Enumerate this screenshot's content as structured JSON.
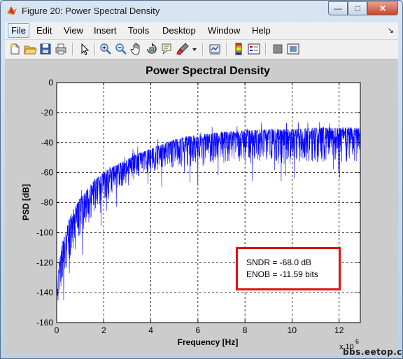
{
  "window": {
    "title": "Figure 20: Power Spectral Density",
    "minimize": "—",
    "maximize": "□",
    "close": "✕"
  },
  "menu": {
    "items": [
      "File",
      "Edit",
      "View",
      "Insert",
      "Tools",
      "Desktop",
      "Window",
      "Help"
    ],
    "dock_arrow": "↘"
  },
  "toolbar": {
    "icons": [
      "new-figure-icon",
      "open-file-icon",
      "save-icon",
      "print-icon",
      "arrow-select-icon",
      "zoom-in-icon",
      "zoom-out-icon",
      "pan-hand-icon",
      "rotate-3d-icon",
      "data-cursor-icon",
      "brush-icon",
      "brush-dropdown-icon",
      "link-plot-icon",
      "colorbar-icon",
      "legend-icon",
      "hide-plot-tools-icon",
      "show-plot-tools-icon"
    ]
  },
  "chart_data": {
    "type": "line",
    "title": "Power Spectral Density",
    "xlabel": "Frequency [Hz]",
    "ylabel": "PSD [dB]",
    "x_multiplier_label": "x 10",
    "x_multiplier_exp": "6",
    "xlim": [
      0,
      12.9
    ],
    "ylim": [
      -160,
      0
    ],
    "xticks": [
      "0",
      "2",
      "4",
      "6",
      "8",
      "10",
      "12"
    ],
    "yticks": [
      "0",
      "-20",
      "-40",
      "-60",
      "-80",
      "-100",
      "-120",
      "-140",
      "-160"
    ],
    "grid": true,
    "line_color": "#0000ff",
    "series": [
      {
        "x": [
          0.05,
          0.1,
          0.2,
          0.3,
          0.4,
          0.5,
          0.7,
          1.0,
          1.3,
          1.6,
          2.0,
          2.5,
          3.0,
          3.5,
          4.0,
          4.5,
          5.0,
          5.5,
          6.0,
          7.0,
          8.0,
          9.0,
          10.0,
          11.0,
          12.0,
          12.9
        ],
        "upper": [
          -128,
          -120,
          -110,
          -103,
          -98,
          -92,
          -85,
          -77,
          -71,
          -65,
          -60,
          -55,
          -51,
          -47,
          -44,
          -41,
          -38,
          -36,
          -35,
          -33,
          -32,
          -31,
          -31,
          -30,
          -30,
          -30
        ],
        "lower": [
          -150,
          -145,
          -138,
          -132,
          -125,
          -120,
          -112,
          -103,
          -95,
          -88,
          -80,
          -73,
          -67,
          -63,
          -60,
          -58,
          -57,
          -56,
          -55,
          -54,
          -54,
          -54,
          -54,
          -53,
          -53,
          -53
        ]
      }
    ],
    "annotation": {
      "line1": "SNDR = -68.0 dB",
      "line2": "ENOB = -11.59 bits",
      "border_color": "#e01010"
    }
  },
  "watermark": "bbs.eetop.cn"
}
